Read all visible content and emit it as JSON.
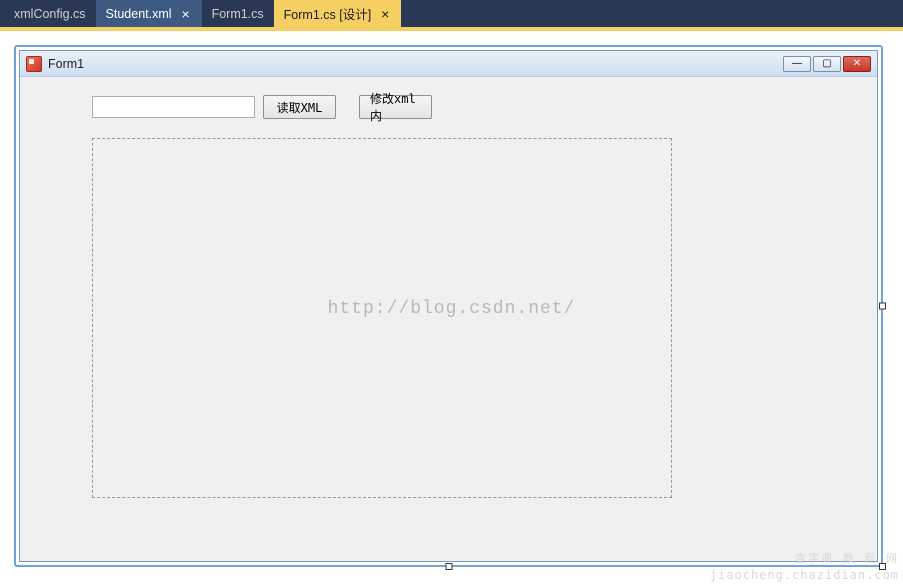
{
  "tabs": [
    {
      "label": "xmlConfig.cs",
      "closable": false,
      "state": "normal"
    },
    {
      "label": "Student.xml",
      "closable": true,
      "state": "selected"
    },
    {
      "label": "Form1.cs",
      "closable": false,
      "state": "normal"
    },
    {
      "label": "Form1.cs [设计]",
      "closable": true,
      "state": "active"
    }
  ],
  "form": {
    "title": "Form1",
    "textbox_value": "",
    "button_read": "读取XML",
    "button_modify": "修改xml内"
  },
  "window_controls": {
    "minimize": "—",
    "maximize": "▢",
    "close": "✕"
  },
  "watermark": "http://blog.csdn.net/",
  "corner_brand_line1": "查字典 教 程 网",
  "corner_brand_line2": "jiaocheng.chazidian.com"
}
